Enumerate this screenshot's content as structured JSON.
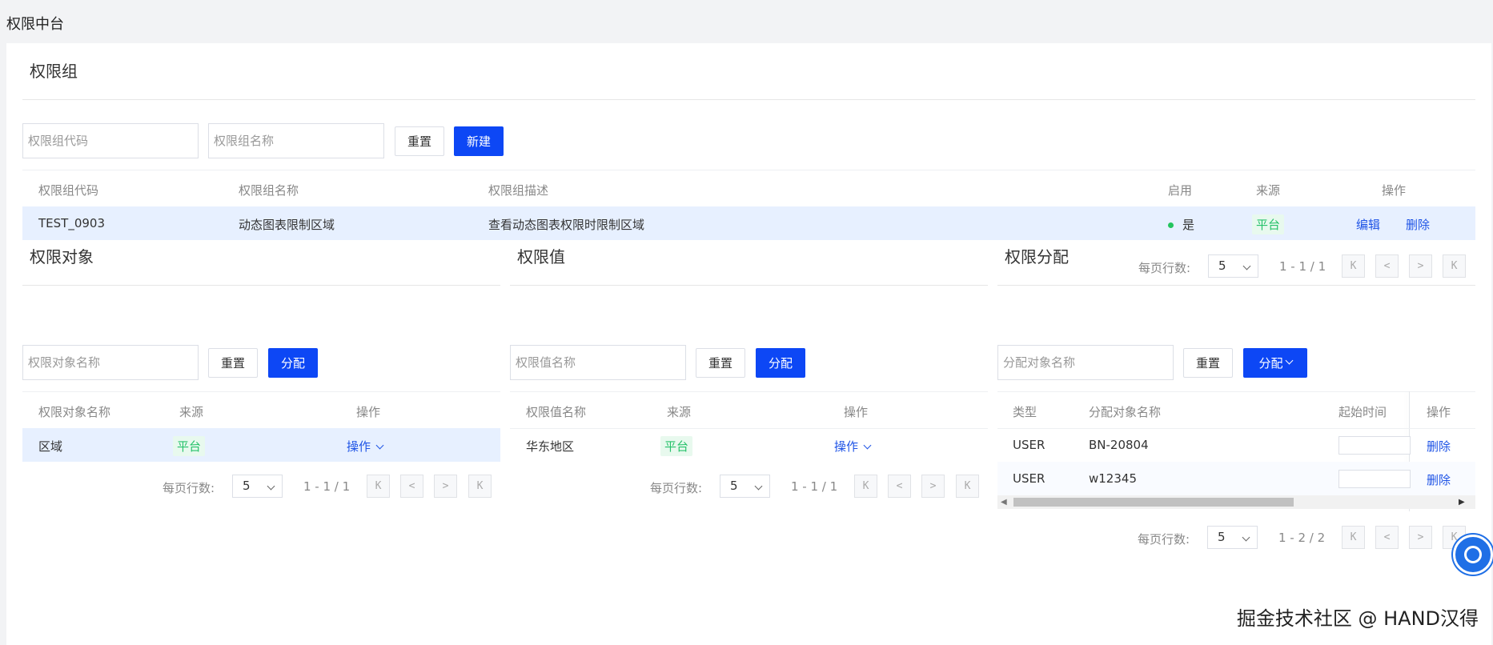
{
  "page": {
    "title": "权限中台"
  },
  "group": {
    "title": "权限组",
    "code_placeholder": "权限组代码",
    "name_placeholder": "权限组名称",
    "reset_label": "重置",
    "new_label": "新建",
    "headers": {
      "code": "权限组代码",
      "name": "权限组名称",
      "desc": "权限组描述",
      "enabled": "启用",
      "source": "来源",
      "action": "操作"
    },
    "rows": [
      {
        "code": "TEST_0903",
        "name": "动态图表限制区域",
        "desc": "查看动态图表权限时限制区域",
        "enabled": "是",
        "source": "平台",
        "edit": "编辑",
        "delete": "删除"
      }
    ],
    "pagination": {
      "label": "每页行数:",
      "size": "5",
      "info": "1 - 1 / 1"
    }
  },
  "object": {
    "title": "权限对象",
    "placeholder": "权限对象名称",
    "reset_label": "重置",
    "assign_label": "分配",
    "headers": {
      "name": "权限对象名称",
      "source": "来源",
      "action": "操作"
    },
    "rows": [
      {
        "name": "区域",
        "source": "平台",
        "action": "操作"
      }
    ],
    "pagination": {
      "label": "每页行数:",
      "size": "5",
      "info": "1 - 1 / 1"
    }
  },
  "value": {
    "title": "权限值",
    "placeholder": "权限值名称",
    "reset_label": "重置",
    "assign_label": "分配",
    "headers": {
      "name": "权限值名称",
      "source": "来源",
      "action": "操作"
    },
    "rows": [
      {
        "name": "华东地区",
        "source": "平台",
        "action": "操作"
      }
    ],
    "pagination": {
      "label": "每页行数:",
      "size": "5",
      "info": "1 - 1 / 1"
    }
  },
  "allocation": {
    "title": "权限分配",
    "placeholder": "分配对象名称",
    "reset_label": "重置",
    "assign_label": "分配",
    "headers": {
      "type": "类型",
      "name": "分配对象名称",
      "start": "起始时间",
      "action": "操作"
    },
    "rows": [
      {
        "type": "USER",
        "name": "BN-20804",
        "delete": "删除"
      },
      {
        "type": "USER",
        "name": "w12345",
        "delete": "删除"
      }
    ],
    "pagination": {
      "label": "每页行数:",
      "size": "5",
      "info": "1 - 2 / 2"
    }
  },
  "pager_icons": {
    "first": "K",
    "prev": "<",
    "next": ">",
    "last": "K"
  },
  "watermark": "掘金技术社区 @ HAND汉得",
  "colors": {
    "primary": "#0d47f5",
    "link": "#1f54e6",
    "success": "#23c45e",
    "row_highlight": "#e7f0ff"
  }
}
